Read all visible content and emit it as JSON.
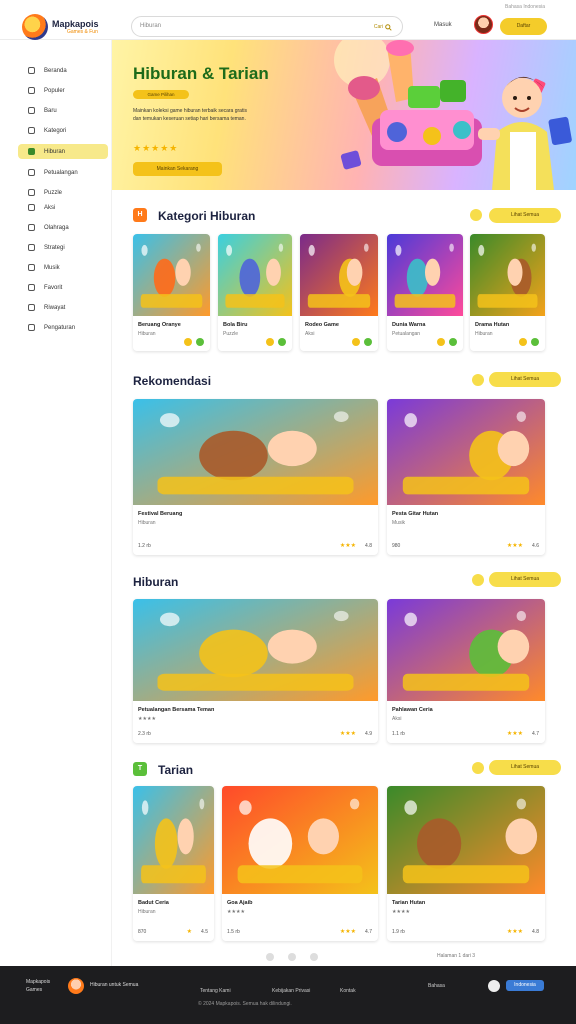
{
  "header": {
    "brand": "Mapkapois",
    "brand_sub": "Games & Fun",
    "search_placeholder": "Hiburan",
    "search_button": "Cari",
    "link": "Masuk",
    "button": "Daftar",
    "top_note": "Bahasa Indonesia"
  },
  "sidebar": {
    "items": [
      {
        "label": "Beranda",
        "icon": "home-icon",
        "active": false
      },
      {
        "label": "Populer",
        "icon": "fire-icon",
        "active": false
      },
      {
        "label": "Baru",
        "icon": "star-icon",
        "active": false
      },
      {
        "label": "Kategori",
        "icon": "grid-icon",
        "active": false
      },
      {
        "label": "Hiburan",
        "icon": "gamepad-icon",
        "active": true
      },
      {
        "label": "Petualangan",
        "icon": "map-icon",
        "active": false
      },
      {
        "label": "Puzzle",
        "icon": "puzzle-icon",
        "active": false
      },
      {
        "label": "Aksi",
        "icon": "bolt-icon",
        "active": false
      },
      {
        "label": "Olahraga",
        "icon": "ball-icon",
        "active": false
      },
      {
        "label": "Strategi",
        "icon": "chess-icon",
        "active": false
      },
      {
        "label": "Musik",
        "icon": "music-icon",
        "active": false
      },
      {
        "label": "Favorit",
        "icon": "heart-icon",
        "active": false
      },
      {
        "label": "Riwayat",
        "icon": "clock-icon",
        "active": false
      },
      {
        "label": "Pengaturan",
        "icon": "gear-icon",
        "active": false
      }
    ]
  },
  "hero": {
    "title": "Hiburan & Tarian",
    "pill": "Game Pilihan",
    "description": "Mainkan koleksi game hiburan terbaik secara gratis dan temukan keseruan setiap hari bersama teman.",
    "stars": "★★★★★",
    "button": "Mainkan Sekarang"
  },
  "section1": {
    "badge": "H",
    "title": "Kategori Hiburan",
    "button": "Lihat Semua",
    "cards": [
      {
        "title": "Beruang Oranye",
        "sub": "Hiburan"
      },
      {
        "title": "Bola Biru",
        "sub": "Puzzle"
      },
      {
        "title": "Rodeo Game",
        "sub": "Aksi"
      },
      {
        "title": "Dunia Warna",
        "sub": "Petualangan"
      },
      {
        "title": "Drama Hutan",
        "sub": "Hiburan"
      }
    ]
  },
  "section2": {
    "badge": "R",
    "title": "Rekomendasi",
    "button": "Lihat Semua",
    "cards": [
      {
        "title": "Festival Beruang",
        "sub": "Hiburan",
        "players": "1.2 rb",
        "rating": "4.8",
        "stars": "★★★"
      },
      {
        "title": "Pesta Gitar Hutan",
        "sub": "Musik",
        "players": "980",
        "rating": "4.6",
        "stars": "★★★"
      }
    ]
  },
  "section3": {
    "badge": "H",
    "title": "Hiburan",
    "button": "Lihat Semua",
    "cards": [
      {
        "title": "Petualangan Bersama Teman",
        "sub": "★★★★",
        "players": "2.3 rb",
        "rating": "4.9",
        "stars": "★★★"
      },
      {
        "title": "Pahlawan Ceria",
        "sub": "Aksi",
        "players": "1.1 rb",
        "rating": "4.7",
        "stars": "★★★"
      }
    ]
  },
  "section4": {
    "badge": "T",
    "title": "Tarian",
    "button": "Lihat Semua",
    "cards": [
      {
        "title": "Badut Ceria",
        "sub": "Hiburan",
        "players": "870",
        "rating": "4.5",
        "stars": "★"
      },
      {
        "title": "Goa Ajaib",
        "sub": "★★★★",
        "players": "1.5 rb",
        "rating": "4.7",
        "stars": "★★★"
      },
      {
        "title": "Tarian Hutan",
        "sub": "★★★★",
        "players": "1.9 rb",
        "rating": "4.8",
        "stars": "★★★"
      }
    ]
  },
  "pager_note": "Halaman 1 dari 3",
  "footer": {
    "brand": "Mapkapois Games",
    "brand2": "Hiburan untuk Semua",
    "links": [
      "Tentang Kami",
      "Kebijakan Privasi",
      "Kontak"
    ],
    "bottom": "© 2024 Mapkapois. Semua hak dilindungi.",
    "right": "Bahasa",
    "button": "Indonesia"
  },
  "colors": {
    "accent": "#f4cc2a",
    "brand": "#1d2340",
    "hero_title": "#1d6b1a",
    "footer_bg": "#1d1d1f"
  }
}
